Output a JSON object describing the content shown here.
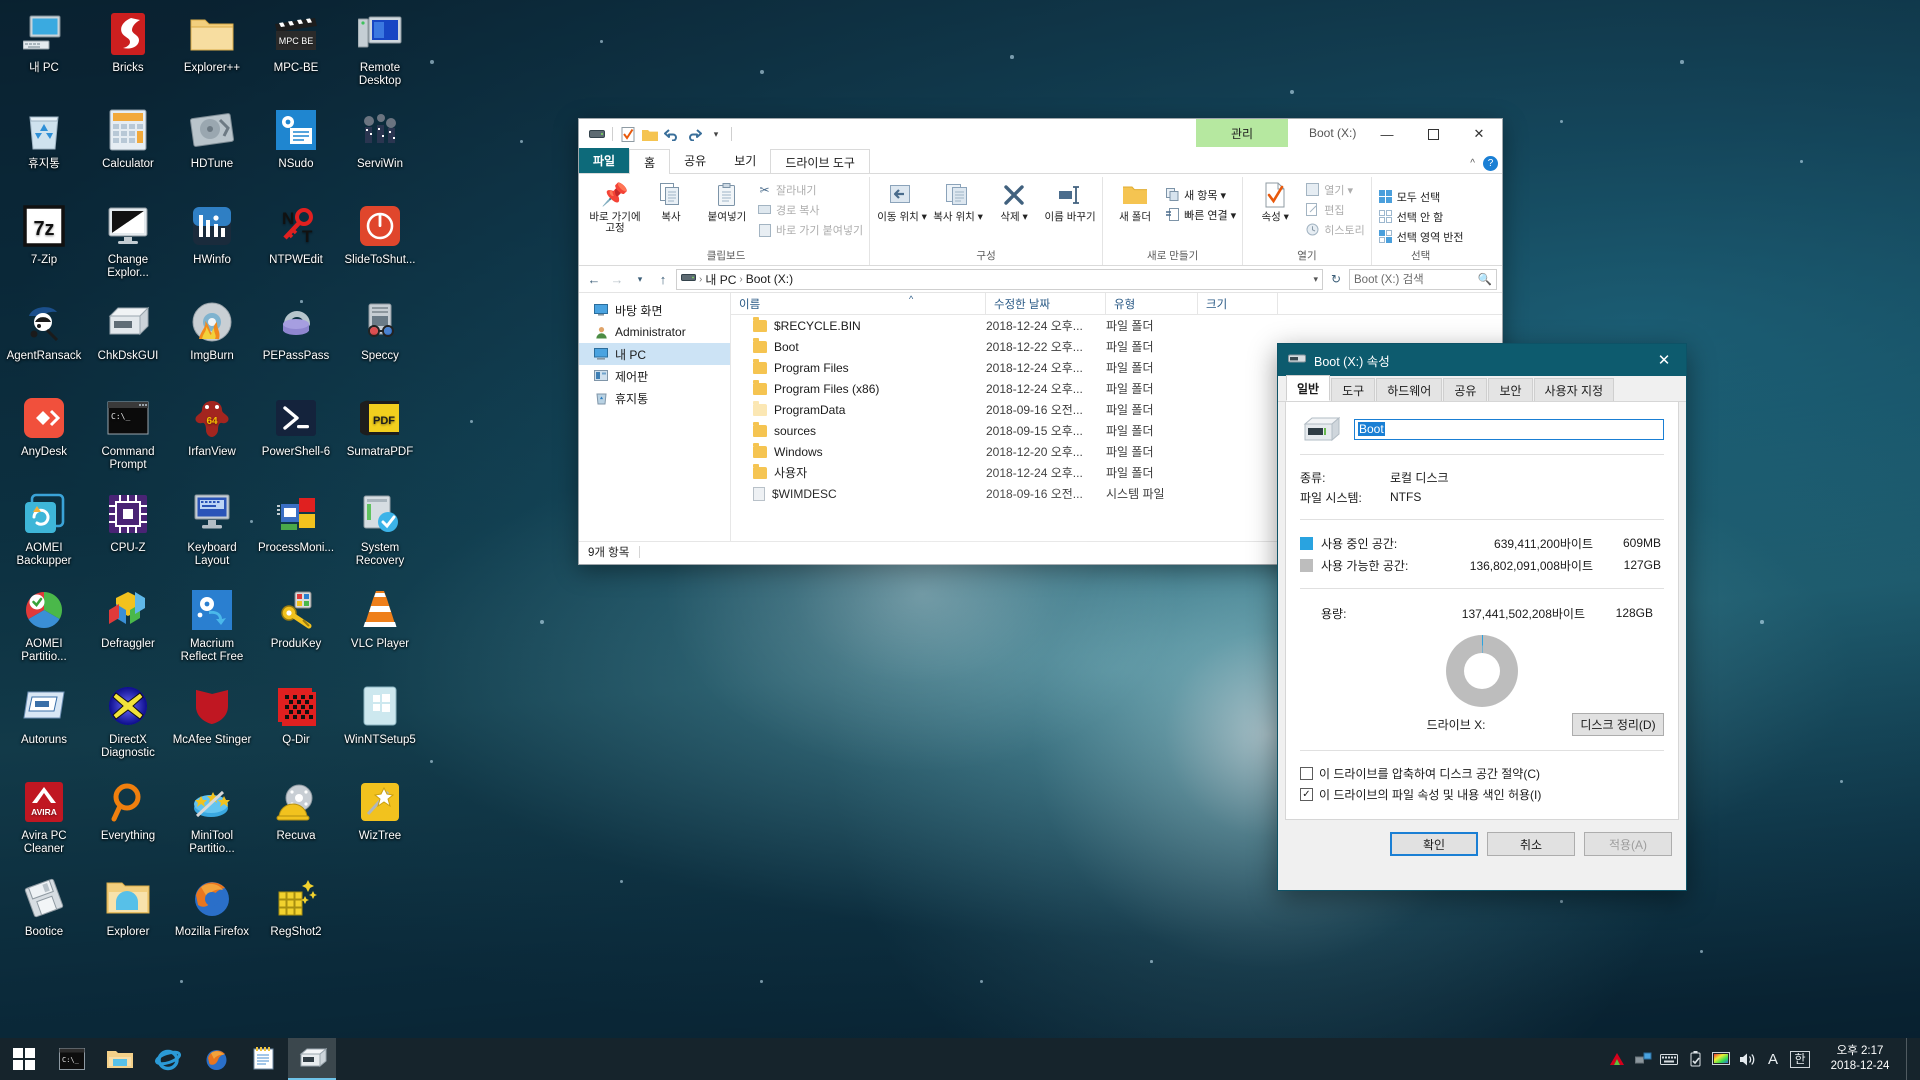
{
  "desktop": {
    "icons": [
      {
        "label": "내 PC",
        "icon": "computer-icon"
      },
      {
        "label": "Bricks",
        "icon": "bricks-icon"
      },
      {
        "label": "Explorer++",
        "icon": "folder-icon"
      },
      {
        "label": "MPC-BE",
        "icon": "clapperboard-icon"
      },
      {
        "label": "Remote Desktop",
        "icon": "remote-desktop-icon"
      },
      {
        "label": "휴지통",
        "icon": "recycle-bin-icon"
      },
      {
        "label": "Calculator",
        "icon": "calculator-icon"
      },
      {
        "label": "HDTune",
        "icon": "harddisk-icon"
      },
      {
        "label": "NSudo",
        "icon": "nsudo-icon"
      },
      {
        "label": "ServiWin",
        "icon": "serviwin-icon"
      },
      {
        "label": "7-Zip",
        "icon": "sevenzip-icon"
      },
      {
        "label": "Change Explor...",
        "icon": "monitor-icon"
      },
      {
        "label": "HWinfo",
        "icon": "hwinfo-icon"
      },
      {
        "label": "NTPWEdit",
        "icon": "key-icon"
      },
      {
        "label": "SlideToShut...",
        "icon": "power-icon"
      },
      {
        "label": "AgentRansack",
        "icon": "detective-icon"
      },
      {
        "label": "ChkDskGUI",
        "icon": "diskdrive-icon"
      },
      {
        "label": "ImgBurn",
        "icon": "cd-burn-icon"
      },
      {
        "label": "PEPassPass",
        "icon": "magnet-icon"
      },
      {
        "label": "Speccy",
        "icon": "speccy-icon"
      },
      {
        "label": "AnyDesk",
        "icon": "anydesk-icon"
      },
      {
        "label": "Command Prompt",
        "icon": "console-icon"
      },
      {
        "label": "IrfanView",
        "icon": "irfanview-icon"
      },
      {
        "label": "PowerShell-6",
        "icon": "powershell-icon"
      },
      {
        "label": "SumatraPDF",
        "icon": "pdf-icon"
      },
      {
        "label": "AOMEI Backupper",
        "icon": "aomei-backup-icon"
      },
      {
        "label": "CPU-Z",
        "icon": "cpu-icon"
      },
      {
        "label": "Keyboard Layout",
        "icon": "keyboard-monitor-icon"
      },
      {
        "label": "ProcessMoni...",
        "icon": "procmon-icon"
      },
      {
        "label": "System Recovery",
        "icon": "system-recovery-icon"
      },
      {
        "label": "AOMEI Partitio...",
        "icon": "aomei-partition-icon"
      },
      {
        "label": "Defraggler",
        "icon": "defraggler-icon"
      },
      {
        "label": "Macrium Reflect Free",
        "icon": "macrium-icon"
      },
      {
        "label": "ProduKey",
        "icon": "produkey-icon"
      },
      {
        "label": "VLC Player",
        "icon": "vlc-cone-icon"
      },
      {
        "label": "Autoruns",
        "icon": "autoruns-icon"
      },
      {
        "label": "DirectX Diagnostic",
        "icon": "directx-icon"
      },
      {
        "label": "McAfee Stinger",
        "icon": "mcafee-shield-icon"
      },
      {
        "label": "Q-Dir",
        "icon": "qdir-icon"
      },
      {
        "label": "WinNTSetup5",
        "icon": "winntsetup-icon"
      },
      {
        "label": "Avira PC Cleaner",
        "icon": "avira-icon"
      },
      {
        "label": "Everything",
        "icon": "magnifier-icon"
      },
      {
        "label": "MiniTool Partitio...",
        "icon": "minitool-icon"
      },
      {
        "label": "Recuva",
        "icon": "recuva-icon"
      },
      {
        "label": "WizTree",
        "icon": "wiztree-icon"
      },
      {
        "label": "Bootice",
        "icon": "floppy-icon"
      },
      {
        "label": "Explorer",
        "icon": "explorer-folder-icon"
      },
      {
        "label": "Mozilla Firefox",
        "icon": "firefox-icon"
      },
      {
        "label": "RegShot2",
        "icon": "regshot-icon"
      }
    ]
  },
  "explorer": {
    "quick_access": {
      "drive_icon": "drive-icon",
      "properties_icon": "properties-check-icon",
      "newfolder_icon": "new-folder-icon",
      "undo_icon": "undo-icon",
      "redo_icon": "redo-icon",
      "customize_icon": "chevron-down-icon"
    },
    "context_tab": "관리",
    "window_title": "Boot (X:)",
    "window_controls": {
      "minimize": "—",
      "maximize": "☐",
      "close": "✕"
    },
    "ribbon_collapse_icon": "chevron-up-icon",
    "help_label": "?",
    "tabs": [
      {
        "label": "파일",
        "kind": "file"
      },
      {
        "label": "홈",
        "kind": "active"
      },
      {
        "label": "공유",
        "kind": "normal"
      },
      {
        "label": "보기",
        "kind": "normal"
      },
      {
        "label": "드라이브 도구",
        "kind": "context"
      }
    ],
    "ribbon_groups": [
      {
        "title": "클립보드",
        "big_buttons": [
          {
            "label": "바로 가기에 고정",
            "icon": "pin-icon"
          },
          {
            "label": "복사",
            "icon": "copy-icon"
          },
          {
            "label": "붙여넣기",
            "icon": "paste-icon"
          }
        ],
        "small_buttons": [
          {
            "label": "잘라내기",
            "icon": "scissors-icon",
            "disabled": true
          },
          {
            "label": "경로 복사",
            "icon": "copy-path-icon",
            "disabled": true
          },
          {
            "label": "바로 가기 붙여넣기",
            "icon": "paste-shortcut-icon",
            "disabled": true
          }
        ]
      },
      {
        "title": "구성",
        "big_buttons": [
          {
            "label": "이동 위치 ▾",
            "icon": "move-to-icon"
          },
          {
            "label": "복사 위치 ▾",
            "icon": "copy-to-icon"
          },
          {
            "label": "삭제 ▾",
            "icon": "delete-x-icon"
          },
          {
            "label": "이름 바꾸기",
            "icon": "rename-icon"
          }
        ],
        "small_buttons": []
      },
      {
        "title": "새로 만들기",
        "big_buttons": [
          {
            "label": "새 폴더",
            "icon": "new-folder-icon"
          }
        ],
        "small_buttons": [
          {
            "label": "새 항목 ▾",
            "icon": "new-item-icon"
          },
          {
            "label": "빠른 연결 ▾",
            "icon": "quick-access-icon"
          }
        ]
      },
      {
        "title": "열기",
        "big_buttons": [
          {
            "label": "속성 ▾",
            "icon": "properties-check-icon"
          }
        ],
        "small_buttons": [
          {
            "label": "열기 ▾",
            "icon": "open-icon",
            "disabled": true
          },
          {
            "label": "편집",
            "icon": "edit-icon",
            "disabled": true
          },
          {
            "label": "히스토리",
            "icon": "history-icon",
            "disabled": true
          }
        ]
      },
      {
        "title": "선택",
        "big_buttons": [],
        "small_buttons": [
          {
            "label": "모두 선택",
            "icon": "select-all-icon"
          },
          {
            "label": "선택 안 함",
            "icon": "select-none-icon"
          },
          {
            "label": "선택 영역 반전",
            "icon": "invert-selection-icon"
          }
        ]
      }
    ],
    "address": {
      "back_icon": "arrow-left-icon",
      "forward_icon": "arrow-right-icon",
      "recent_icon": "chevron-down-icon",
      "up_icon": "arrow-up-icon",
      "crumb_drive_icon": "drive-icon",
      "crumbs": [
        "내 PC",
        "Boot (X:)"
      ],
      "dropdown_icon": "chevron-down-icon",
      "refresh_icon": "refresh-icon",
      "search_placeholder": "Boot (X:) 검색",
      "search_icon": "search-icon"
    },
    "nav_pane": [
      {
        "label": "바탕 화면",
        "icon": "desktop-icon",
        "selected": false
      },
      {
        "label": "Administrator",
        "icon": "user-icon",
        "selected": false
      },
      {
        "label": "내 PC",
        "icon": "computer-icon",
        "selected": true
      },
      {
        "label": "제어판",
        "icon": "control-panel-icon",
        "selected": false
      },
      {
        "label": "휴지통",
        "icon": "recycle-bin-icon",
        "selected": false
      }
    ],
    "columns": [
      "이름",
      "수정한 날짜",
      "유형",
      "크기"
    ],
    "files": [
      {
        "name": "$RECYCLE.BIN",
        "date": "2018-12-24 오후...",
        "type": "파일 폴더",
        "size": "",
        "icon": "folder-icon"
      },
      {
        "name": "Boot",
        "date": "2018-12-22 오후...",
        "type": "파일 폴더",
        "size": "",
        "icon": "folder-icon"
      },
      {
        "name": "Program Files",
        "date": "2018-12-24 오후...",
        "type": "파일 폴더",
        "size": "",
        "icon": "folder-icon"
      },
      {
        "name": "Program Files (x86)",
        "date": "2018-12-24 오후...",
        "type": "파일 폴더",
        "size": "",
        "icon": "folder-icon"
      },
      {
        "name": "ProgramData",
        "date": "2018-09-16 오전...",
        "type": "파일 폴더",
        "size": "",
        "icon": "folder-pale-icon"
      },
      {
        "name": "sources",
        "date": "2018-09-15 오후...",
        "type": "파일 폴더",
        "size": "",
        "icon": "folder-icon"
      },
      {
        "name": "Windows",
        "date": "2018-12-20 오후...",
        "type": "파일 폴더",
        "size": "",
        "icon": "folder-icon"
      },
      {
        "name": "사용자",
        "date": "2018-12-24 오후...",
        "type": "파일 폴더",
        "size": "",
        "icon": "folder-icon"
      },
      {
        "name": "$WIMDESC",
        "date": "2018-09-16 오전...",
        "type": "시스템 파일",
        "size": "",
        "icon": "system-file-icon"
      }
    ],
    "status": "9개 항목"
  },
  "properties_dialog": {
    "title": "Boot (X:) 속성",
    "title_icon": "drive-icon",
    "close_icon": "close-icon",
    "tabs": [
      {
        "label": "일반",
        "active": true
      },
      {
        "label": "도구",
        "active": false
      },
      {
        "label": "하드웨어",
        "active": false
      },
      {
        "label": "공유",
        "active": false
      },
      {
        "label": "보안",
        "active": false
      },
      {
        "label": "사용자 지정",
        "active": false
      }
    ],
    "volume_name": "Boot",
    "fields": [
      {
        "key": "종류:",
        "value": "로컬 디스크"
      },
      {
        "key": "파일 시스템:",
        "value": "NTFS"
      }
    ],
    "used": {
      "label": "사용 중인 공간:",
      "bytes": "639,411,200바이트",
      "human": "609MB",
      "color": "#29a3e0"
    },
    "free": {
      "label": "사용 가능한 공간:",
      "bytes": "136,802,091,008바이트",
      "human": "127GB",
      "color": "#bdbdbd"
    },
    "capacity": {
      "label": "용량:",
      "bytes": "137,441,502,208바이트",
      "human": "128GB"
    },
    "drive_caption": "드라이브 X:",
    "cleanup_button": "디스크 정리(D)",
    "checkboxes": [
      {
        "label": "이 드라이브를 압축하여 디스크 공간 절약(C)",
        "checked": false
      },
      {
        "label": "이 드라이브의 파일 속성 및 내용 색인 허용(I)",
        "checked": true
      }
    ],
    "buttons": [
      {
        "label": "확인",
        "style": "default"
      },
      {
        "label": "취소",
        "style": "normal"
      },
      {
        "label": "적용(A)",
        "style": "disabled"
      }
    ]
  },
  "taskbar": {
    "start_icon": "windows-logo-icon",
    "items": [
      {
        "icon": "console-icon",
        "active": false
      },
      {
        "icon": "explorer-folder-icon",
        "active": false
      },
      {
        "icon": "internet-explorer-icon",
        "active": false
      },
      {
        "icon": "firefox-icon",
        "active": false
      },
      {
        "icon": "notepad-icon",
        "active": false
      },
      {
        "icon": "drive-window-icon",
        "active": true
      }
    ],
    "tray": [
      {
        "icon": "avira-tray-icon"
      },
      {
        "icon": "network-icon"
      },
      {
        "icon": "keyboard-icon"
      },
      {
        "icon": "usb-eject-icon"
      },
      {
        "icon": "display-color-icon"
      },
      {
        "icon": "volume-icon"
      },
      {
        "icon": "font-icon"
      },
      {
        "icon": "ime-korean-icon"
      }
    ],
    "clock": {
      "time": "오후 2:17",
      "date": "2018-12-24"
    }
  }
}
